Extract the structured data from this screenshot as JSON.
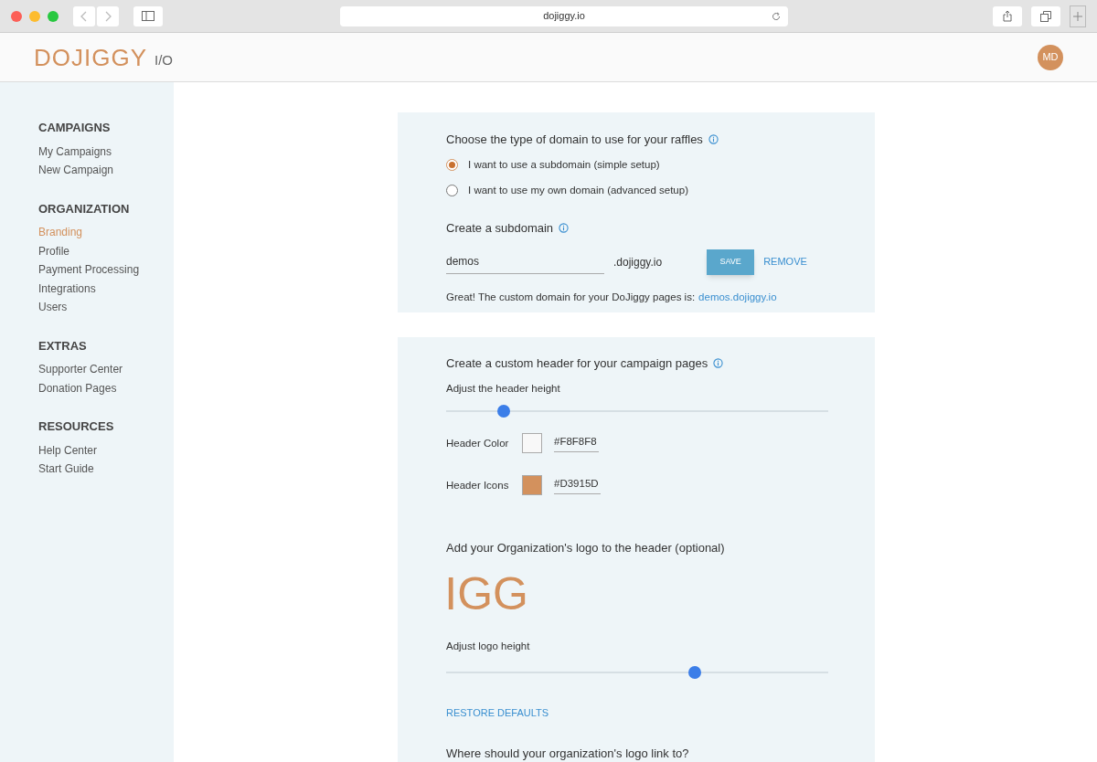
{
  "browser": {
    "url": "dojiggy.io"
  },
  "header": {
    "logo": "DOJIGGY",
    "logo_suffix": "I/O",
    "avatar": "MD"
  },
  "sidebar": {
    "sections": [
      {
        "title": "CAMPAIGNS",
        "items": [
          {
            "label": "My Campaigns",
            "selected": false
          },
          {
            "label": "New Campaign",
            "selected": false
          }
        ]
      },
      {
        "title": "ORGANIZATION",
        "items": [
          {
            "label": "Branding",
            "selected": true
          },
          {
            "label": "Profile",
            "selected": false
          },
          {
            "label": "Payment Processing",
            "selected": false
          },
          {
            "label": "Integrations",
            "selected": false
          },
          {
            "label": "Users",
            "selected": false
          }
        ]
      },
      {
        "title": "EXTRAS",
        "items": [
          {
            "label": "Supporter Center",
            "selected": false
          },
          {
            "label": "Donation Pages",
            "selected": false
          }
        ]
      },
      {
        "title": "RESOURCES",
        "items": [
          {
            "label": "Help Center",
            "selected": false
          },
          {
            "label": "Start Guide",
            "selected": false
          }
        ]
      }
    ]
  },
  "domain_card": {
    "title": "Choose the type of domain to use for your raffles",
    "options": [
      {
        "label": "I want to use a subdomain (simple setup)",
        "selected": true
      },
      {
        "label": "I want to use my own domain (advanced setup)",
        "selected": false
      }
    ],
    "subdomain_title": "Create a subdomain",
    "subdomain_value": "demos",
    "suffix": ".dojiggy.io",
    "save": "SAVE",
    "remove": "REMOVE",
    "message": "Great! The custom domain for your DoJiggy pages is:",
    "message_link": "demos.dojiggy.io"
  },
  "header_card": {
    "title": "Create a custom header for your campaign pages",
    "height_slider": {
      "label": "Adjust the header height",
      "level": 0.15
    },
    "colors": [
      {
        "label": "Header Color",
        "value": "#F8F8F8",
        "color": "#f8f8f8"
      },
      {
        "label": "Header Icons",
        "value": "#D3915D",
        "color": "#d3915d"
      }
    ],
    "logo_title": "Add your Organization's logo to the header (optional)",
    "logo_preview": "IGG",
    "logo_slider": {
      "label": "Adjust logo height",
      "level": 0.65
    },
    "restore": "RESTORE DEFAULTS",
    "link_title": "Where should your organization's logo link to?"
  }
}
